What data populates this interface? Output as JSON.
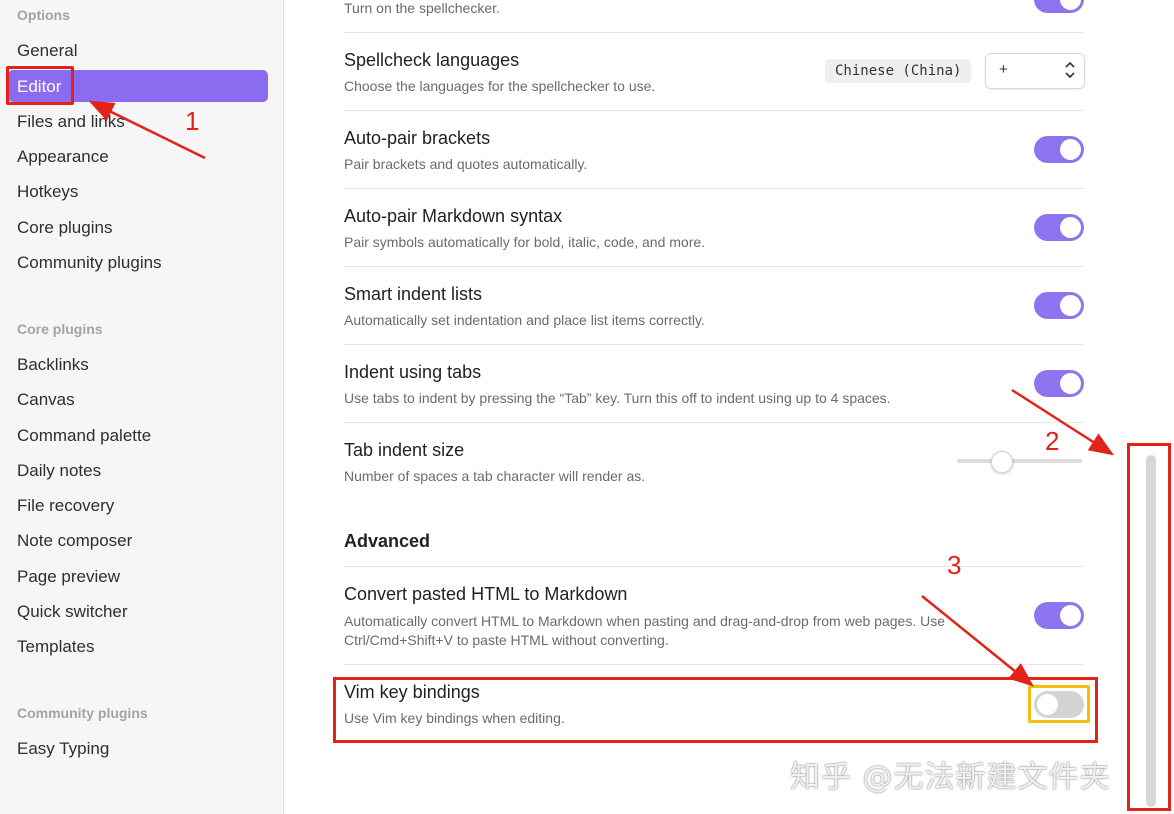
{
  "sidebar": {
    "options_heading": "Options",
    "options_items": [
      "General",
      "Editor",
      "Files and links",
      "Appearance",
      "Hotkeys",
      "Core plugins",
      "Community plugins"
    ],
    "active_item": "Editor",
    "core_heading": "Core plugins",
    "core_items": [
      "Backlinks",
      "Canvas",
      "Command palette",
      "Daily notes",
      "File recovery",
      "Note composer",
      "Page preview",
      "Quick switcher",
      "Templates"
    ],
    "community_heading": "Community plugins",
    "community_items": [
      "Easy Typing"
    ]
  },
  "settings": {
    "spellcheck_desc": "Turn on the spellchecker.",
    "spellcheck_languages": {
      "title": "Spellcheck languages",
      "desc": "Choose the languages for the spellchecker to use.",
      "selected_language": "Chinese (China)",
      "add_value": "+"
    },
    "auto_pair_brackets": {
      "title": "Auto-pair brackets",
      "desc": "Pair brackets and quotes automatically.",
      "enabled": true
    },
    "auto_pair_markdown": {
      "title": "Auto-pair Markdown syntax",
      "desc": "Pair symbols automatically for bold, italic, code, and more.",
      "enabled": true
    },
    "smart_indent": {
      "title": "Smart indent lists",
      "desc": "Automatically set indentation and place list items correctly.",
      "enabled": true
    },
    "indent_tabs": {
      "title": "Indent using tabs",
      "desc": "Use tabs to indent by pressing the “Tab” key. Turn this off to indent using up to 4 spaces.",
      "enabled": true
    },
    "tab_indent_size": {
      "title": "Tab indent size",
      "desc": "Number of spaces a tab character will render as.",
      "value_fraction": 0.35
    },
    "advanced_heading": "Advanced",
    "convert_html": {
      "title": "Convert pasted HTML to Markdown",
      "desc_line1": "Automatically convert HTML to Markdown when pasting and drag-and-drop from web pages. Use",
      "desc_line2": "Ctrl/Cmd+Shift+V to paste HTML without converting.",
      "enabled": true
    },
    "vim_bindings": {
      "title": "Vim key bindings",
      "desc": "Use Vim key bindings when editing.",
      "enabled": false
    }
  },
  "annotations": {
    "label_1": "1",
    "label_2": "2",
    "label_3": "3",
    "color": "#e2231a",
    "highlight_color": "#f2c10f"
  },
  "watermark": "知乎 @无法新建文件夹",
  "colors": {
    "accent": "#8b6cf0",
    "toggle_on": "#8f74ef",
    "toggle_off": "#d3d3d3"
  }
}
